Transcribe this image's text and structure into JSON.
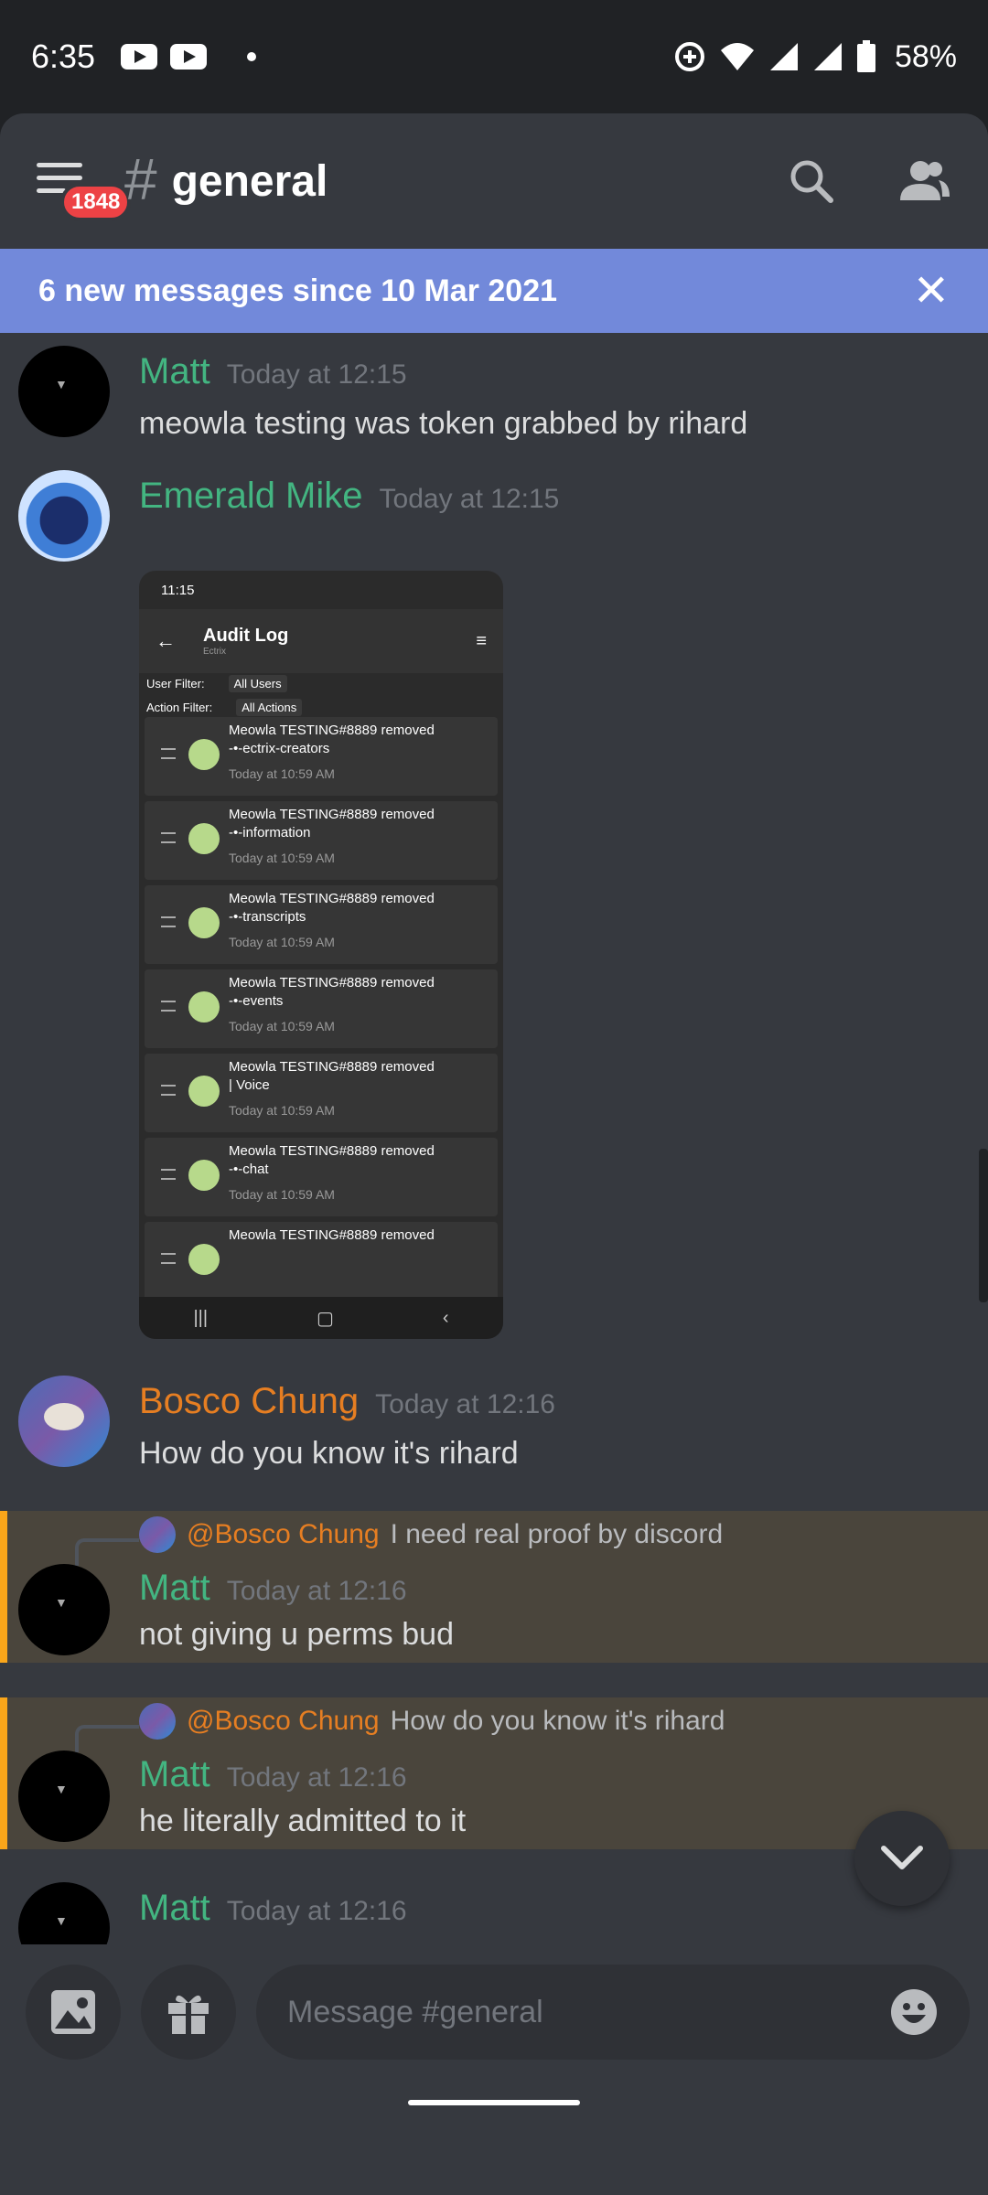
{
  "status_bar": {
    "time": "6:35",
    "battery": "58%"
  },
  "header": {
    "badge": "1848",
    "channel": "general"
  },
  "new_messages_banner": {
    "text": "6 new messages since 10 Mar 2021"
  },
  "messages": [
    {
      "author": "Matt",
      "timestamp": "Today at 12:15",
      "text": "meowla testing was token grabbed by rihard"
    },
    {
      "author": "Emerald Mike",
      "timestamp": "Today at 12:15"
    },
    {
      "author": "Bosco Chung",
      "timestamp": "Today at 12:16",
      "text": "How do you know it's rihard"
    },
    {
      "author": "Matt",
      "timestamp": "Today at 12:16",
      "text": "not giving u perms bud",
      "reply": {
        "mention": "@Bosco Chung",
        "text": "I need real proof by discord"
      }
    },
    {
      "author": "Matt",
      "timestamp": "Today at 12:16",
      "text": "he literally admitted to it",
      "reply": {
        "mention": "@Bosco Chung",
        "text": "How do you know it's rihard"
      }
    },
    {
      "author": "Matt",
      "timestamp": "Today at 12:16"
    }
  ],
  "screenshot": {
    "time": "11:15",
    "title": "Audit Log",
    "subtitle": "Ectrix",
    "user_filter_label": "User Filter:",
    "user_filter_value": "All Users",
    "action_filter_label": "Action Filter:",
    "action_filter_value": "All Actions",
    "entries": [
      {
        "line1": "Meowla TESTING#8889 removed",
        "line2": "-•-ectrix-creators",
        "time": "Today at 10:59 AM"
      },
      {
        "line1": "Meowla TESTING#8889 removed",
        "line2": "-•-information",
        "time": "Today at 10:59 AM"
      },
      {
        "line1": "Meowla TESTING#8889 removed",
        "line2": "-•-transcripts",
        "time": "Today at 10:59 AM"
      },
      {
        "line1": "Meowla TESTING#8889 removed",
        "line2": "-•-events",
        "time": "Today at 10:59 AM"
      },
      {
        "line1": "Meowla TESTING#8889 removed",
        "line2": "| Voice",
        "time": "Today at 10:59 AM"
      },
      {
        "line1": "Meowla TESTING#8889 removed",
        "line2": "-•-chat",
        "time": "Today at 10:59 AM"
      },
      {
        "line1": "Meowla TESTING#8889 removed",
        "line2": "",
        "time": ""
      }
    ]
  },
  "composer": {
    "placeholder": "Message #general"
  },
  "colors": {
    "accent": "#7289da",
    "matt": "#43b581",
    "bosco": "#e67e22",
    "reply_highlight": "#faa61a"
  }
}
